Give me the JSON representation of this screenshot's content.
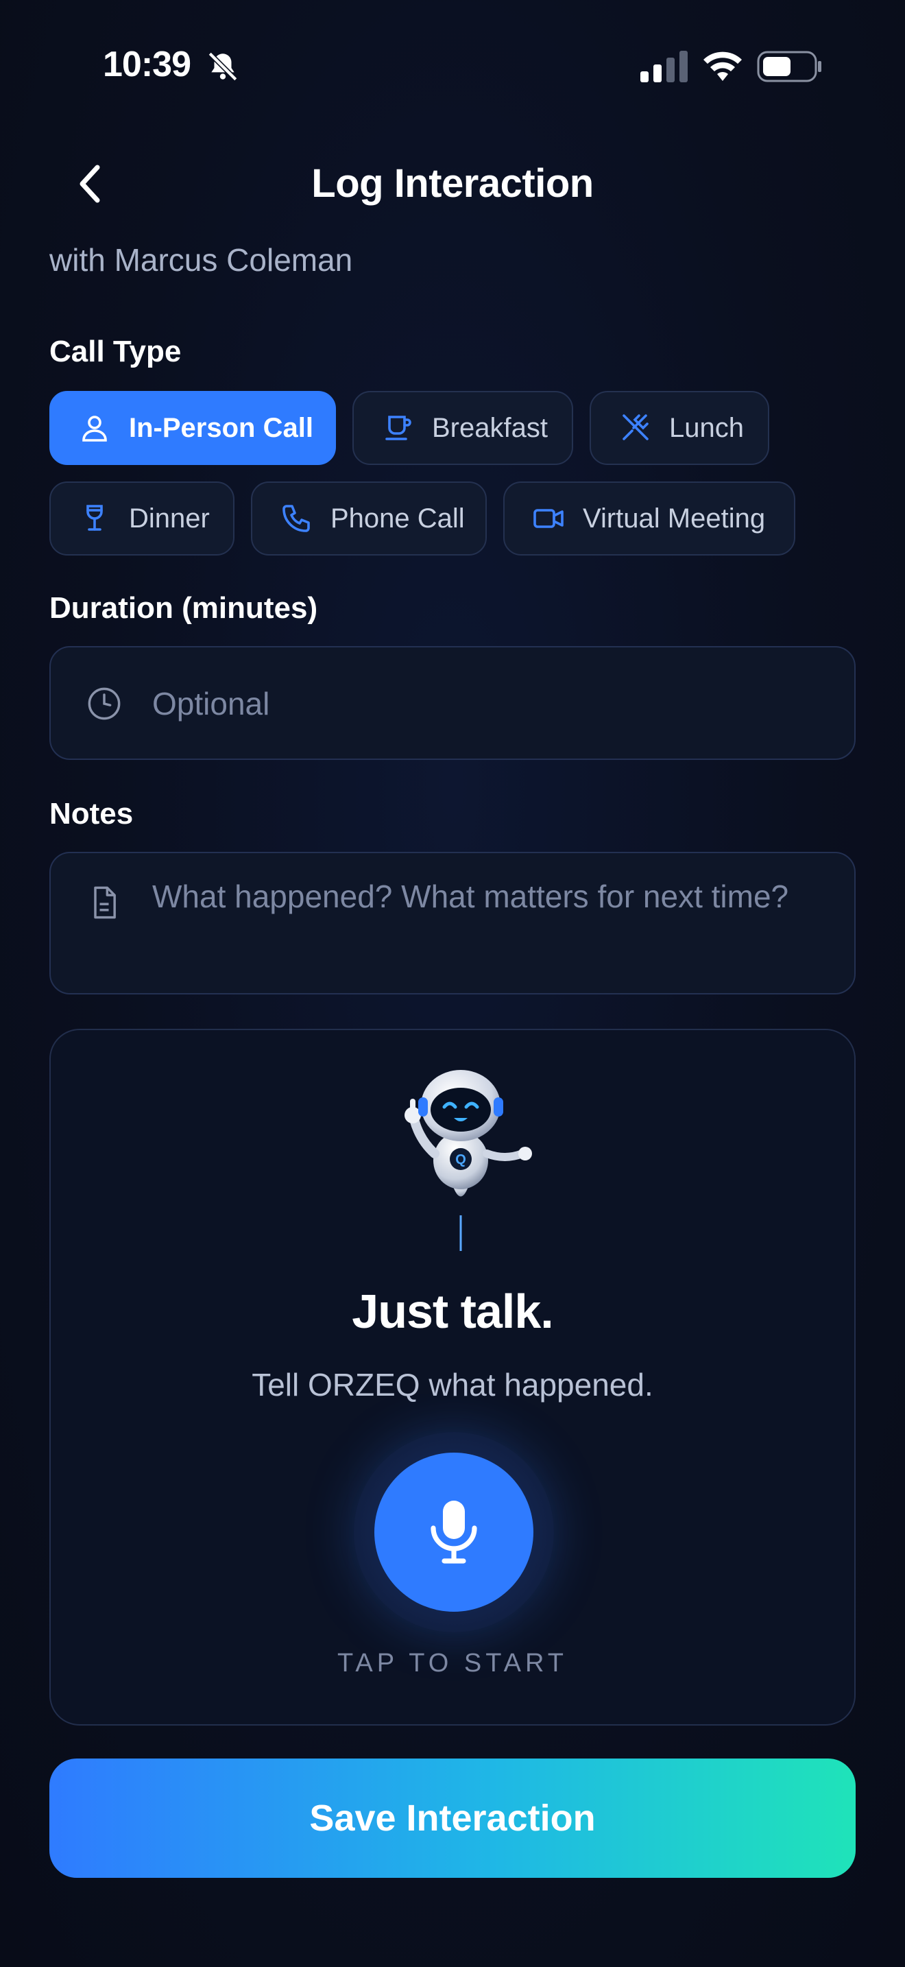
{
  "status_bar": {
    "time": "10:39"
  },
  "header": {
    "title": "Log Interaction",
    "subtitle": "with Marcus Coleman"
  },
  "call_type": {
    "label": "Call Type",
    "selected": "In-Person Call",
    "options": [
      {
        "label": "In-Person Call",
        "icon": "person-icon"
      },
      {
        "label": "Breakfast",
        "icon": "coffee-cup-icon"
      },
      {
        "label": "Lunch",
        "icon": "fork-knife-icon"
      },
      {
        "label": "Dinner",
        "icon": "wine-glass-icon"
      },
      {
        "label": "Phone Call",
        "icon": "phone-icon"
      },
      {
        "label": "Virtual Meeting",
        "icon": "video-camera-icon"
      }
    ]
  },
  "duration": {
    "label": "Duration (minutes)",
    "placeholder": "Optional",
    "value": ""
  },
  "notes": {
    "label": "Notes",
    "placeholder": "What happened? What matters for next time?",
    "value": ""
  },
  "voice": {
    "title": "Just talk.",
    "subtitle": "Tell ORZEQ what happened.",
    "mic_label": "TAP TO START",
    "mascot_letter": "Q"
  },
  "save_label": "Save Interaction",
  "colors": {
    "background": "#0a0f1e",
    "accent": "#2f7bff",
    "gradient_end": "#1fe3b9",
    "card_border": "#233052",
    "muted_text": "#7d88a3"
  }
}
